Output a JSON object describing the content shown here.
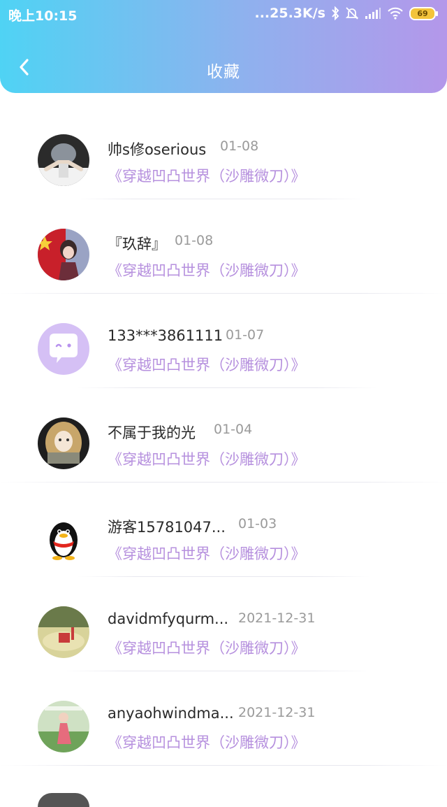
{
  "status_bar": {
    "time": "晚上10:15",
    "network_speed": "...25.3K/s",
    "battery_level": "69",
    "icons": [
      "bluetooth-icon",
      "mute-bell-icon",
      "signal-icon",
      "wifi-icon",
      "battery-icon"
    ]
  },
  "header": {
    "title": "收藏",
    "back_icon": "chevron-left-icon",
    "gradient_colors": [
      "#4fd3f4",
      "#b497ea"
    ]
  },
  "items": [
    {
      "name": "帅s修oserious",
      "date": "01-08",
      "book": "《穿越凹凸世界（沙雕微刀）》",
      "avatar": "avatar-photo-hands"
    },
    {
      "name": "『玖辞』",
      "date": "01-08",
      "book": "《穿越凹凸世界（沙雕微刀）》",
      "avatar": "avatar-flag-girl"
    },
    {
      "name": "133***3861111",
      "date": "01-07",
      "book": "《穿越凹凸世界（沙雕微刀）》",
      "avatar": "avatar-default-chat"
    },
    {
      "name": "不属于我的光",
      "date": "01-04",
      "book": "《穿越凹凸世界（沙雕微刀）》",
      "avatar": "avatar-anime-girl"
    },
    {
      "name": "游客15781047...",
      "date": "01-03",
      "book": "《穿越凹凸世界（沙雕微刀）》",
      "avatar": "avatar-penguin"
    },
    {
      "name": "davidmfyqurm...",
      "date": "2021-12-31",
      "book": "《穿越凹凸世界（沙雕微刀）》",
      "avatar": "avatar-yellow-scene"
    },
    {
      "name": "anyaohwindma...",
      "date": "2021-12-31",
      "book": "《穿越凹凸世界（沙雕微刀）》",
      "avatar": "avatar-green-scene"
    }
  ],
  "colors": {
    "book_title": "#b690de",
    "date": "#9a9a9a"
  }
}
